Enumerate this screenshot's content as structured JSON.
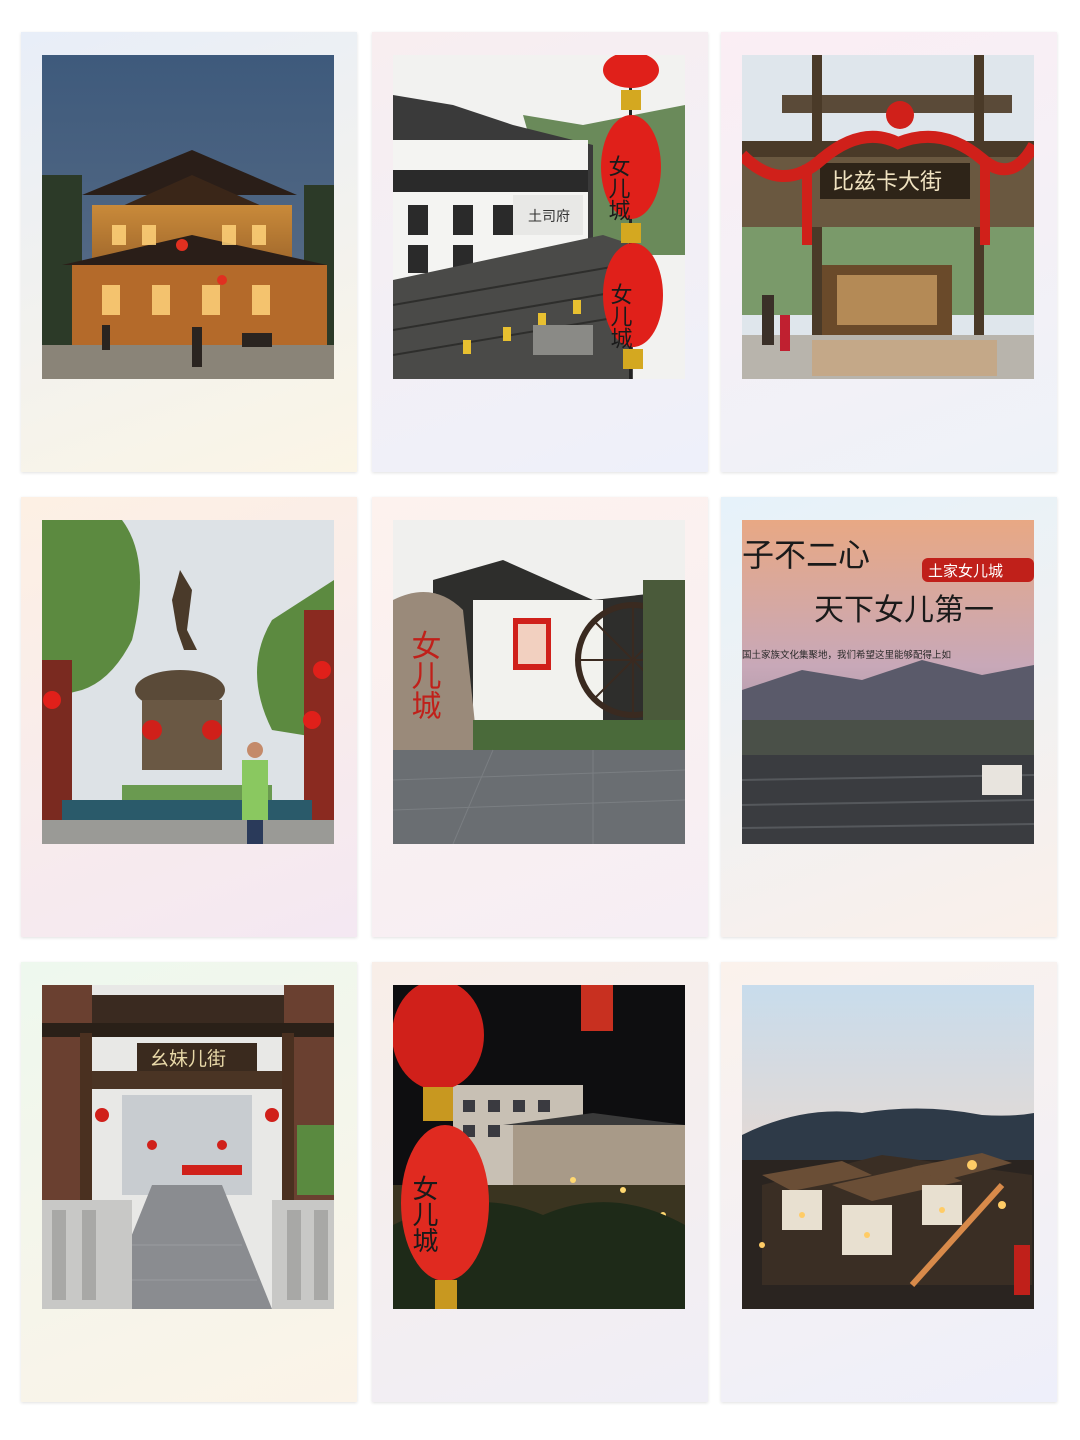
{
  "grid": {
    "rows": 3,
    "columns": 3,
    "frame_style": "polaroid",
    "photos": [
      {
        "subject": "night-pagoda-pavilion",
        "frame_gradient": [
          "#e6eef8",
          "#fbf5e8"
        ]
      },
      {
        "subject": "red-lanterns-street-view",
        "lantern_text_1": "女儿城",
        "lantern_text_2": "女儿城",
        "shop_sign": "土司府",
        "frame_gradient": [
          "#f8eef0",
          "#eef0fa"
        ]
      },
      {
        "subject": "decorated-archway",
        "archway_sign": "比兹卡大街",
        "frame_gradient": [
          "#fbeef4",
          "#eef2f8"
        ]
      },
      {
        "subject": "dancer-statue-plaza",
        "frame_gradient": [
          "#fdf0e6",
          "#f6eaf2"
        ]
      },
      {
        "subject": "stone-and-waterwheel",
        "rock_inscription": "女儿城",
        "frame_gradient": [
          "#fdf2ee",
          "#f6eef4"
        ]
      },
      {
        "subject": "title-over-rooftops",
        "line_1": "子不二心",
        "badge": "土家女儿城",
        "line_2": "天下女儿第一",
        "subline": "国土家族文化集聚地，我们希望这里能够配得上如",
        "frame_gradient": [
          "#e8f4fa",
          "#f8f0ec"
        ]
      },
      {
        "subject": "street-gate",
        "gate_sign": "幺妹儿街",
        "frame_gradient": [
          "#eef8ee",
          "#fbf3ea"
        ]
      },
      {
        "subject": "night-lanterns",
        "lantern_text": "女儿城",
        "frame_gradient": [
          "#f8eeea",
          "#f2eef6"
        ]
      },
      {
        "subject": "dusk-aerial-town",
        "frame_gradient": [
          "#fbf2ec",
          "#eef0fa"
        ]
      }
    ]
  }
}
